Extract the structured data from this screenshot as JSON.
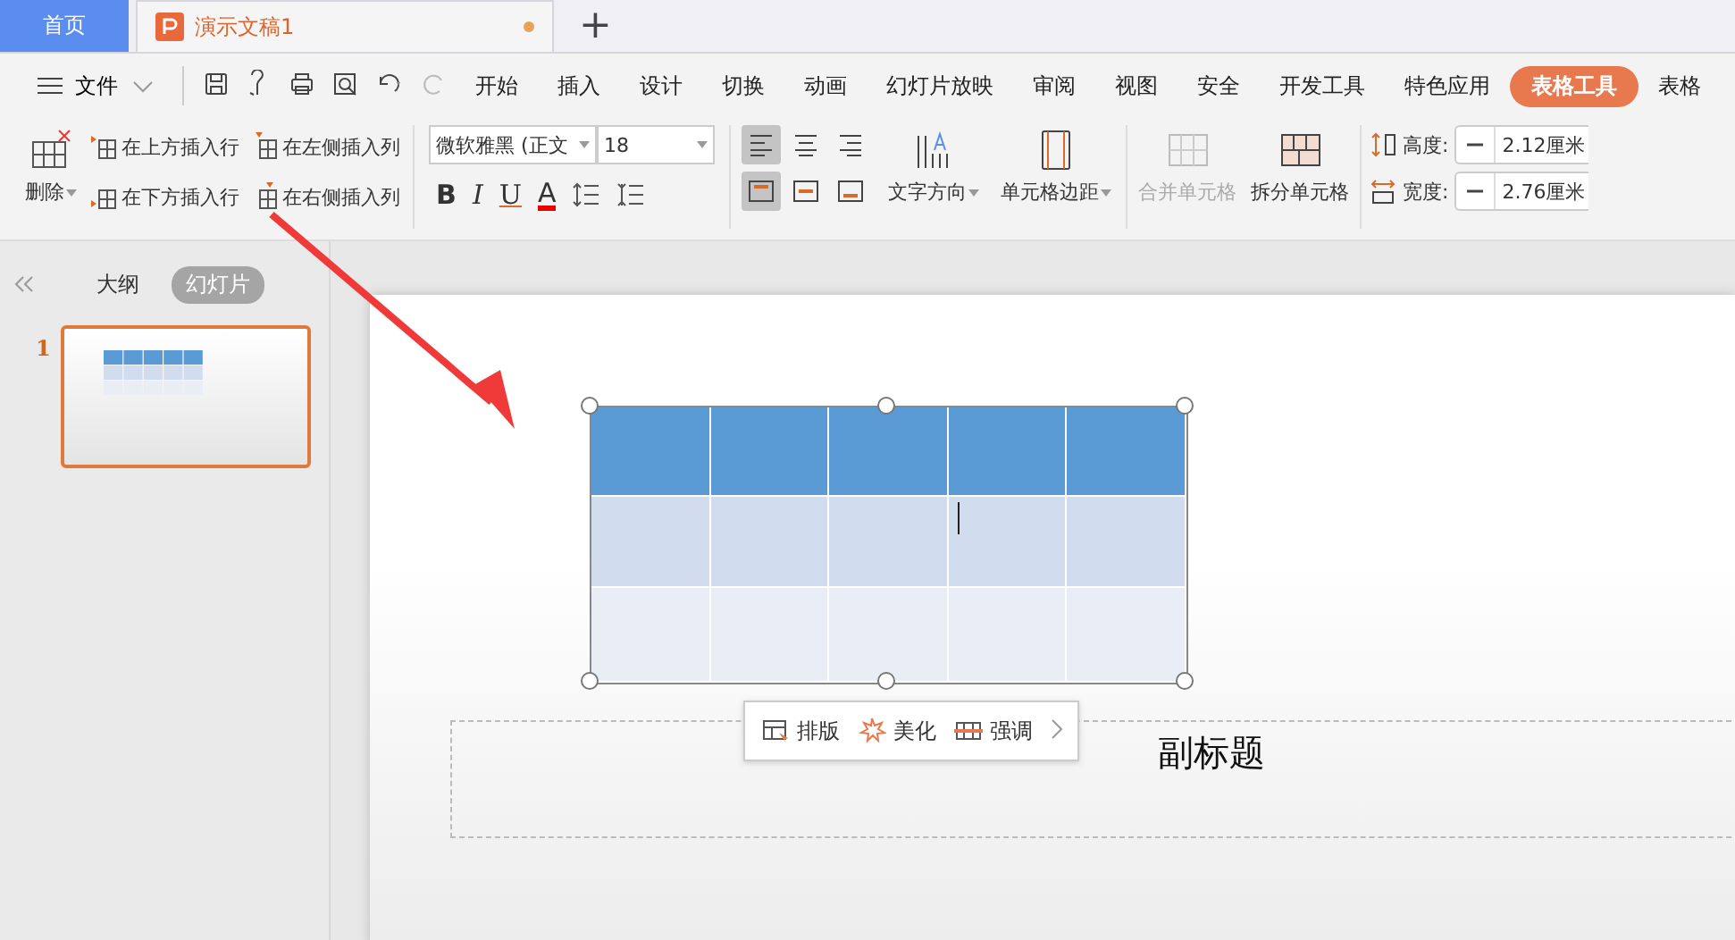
{
  "tabs": [
    {
      "label": "首页",
      "kind": "home",
      "selected": false
    },
    {
      "label": "演示文稿1",
      "kind": "doc",
      "selected": true,
      "modified": true
    }
  ],
  "new_tab": "+",
  "menu": {
    "file": "文件",
    "items": [
      {
        "label": "开始",
        "selected": false
      },
      {
        "label": "插入",
        "selected": false
      },
      {
        "label": "设计",
        "selected": false
      },
      {
        "label": "切换",
        "selected": false
      },
      {
        "label": "动画",
        "selected": false
      },
      {
        "label": "幻灯片放映",
        "selected": false
      },
      {
        "label": "审阅",
        "selected": false
      },
      {
        "label": "视图",
        "selected": false
      },
      {
        "label": "安全",
        "selected": false
      },
      {
        "label": "开发工具",
        "selected": false
      },
      {
        "label": "特色应用",
        "selected": false
      },
      {
        "label": "表格工具",
        "selected": true
      },
      {
        "label": "表格",
        "selected": false
      }
    ]
  },
  "ribbon": {
    "delete": "删除",
    "insert": [
      "在上方插入行",
      "在左侧插入列",
      "在下方插入行",
      "在右侧插入列"
    ],
    "font": "微软雅黑 (正文",
    "size": "18",
    "format": [
      "B",
      "I",
      "U",
      "A"
    ],
    "h_align": [
      {
        "kind": "left",
        "selected": true
      },
      {
        "kind": "center",
        "selected": false
      },
      {
        "kind": "right",
        "selected": false
      }
    ],
    "v_align": [
      {
        "kind": "top",
        "selected": true
      },
      {
        "kind": "middle",
        "selected": false
      },
      {
        "kind": "bottom",
        "selected": false
      }
    ],
    "text_direction": "文字方向",
    "cell_margin": "单元格边距",
    "merge": {
      "label": "合并单元格",
      "disabled": true
    },
    "split": {
      "label": "拆分单元格",
      "disabled": false
    },
    "height": {
      "label": "高度:",
      "value": "2.12厘米"
    },
    "width": {
      "label": "宽度:",
      "value": "2.76厘米"
    }
  },
  "panel": {
    "tabs": [
      {
        "label": "大纲",
        "selected": false
      },
      {
        "label": "幻灯片",
        "selected": true
      }
    ],
    "slides": [
      {
        "number": "1",
        "selected": true
      }
    ]
  },
  "slide": {
    "table": {
      "rows": [
        {
          "kind": "header"
        },
        {
          "kind": "band1"
        },
        {
          "kind": "band2"
        }
      ]
    },
    "subtitle": "副标题"
  },
  "float_toolbar": [
    {
      "label": "排版",
      "kind": "layout"
    },
    {
      "label": "美化",
      "kind": "beautify"
    },
    {
      "label": "强调",
      "kind": "emphasis"
    }
  ]
}
